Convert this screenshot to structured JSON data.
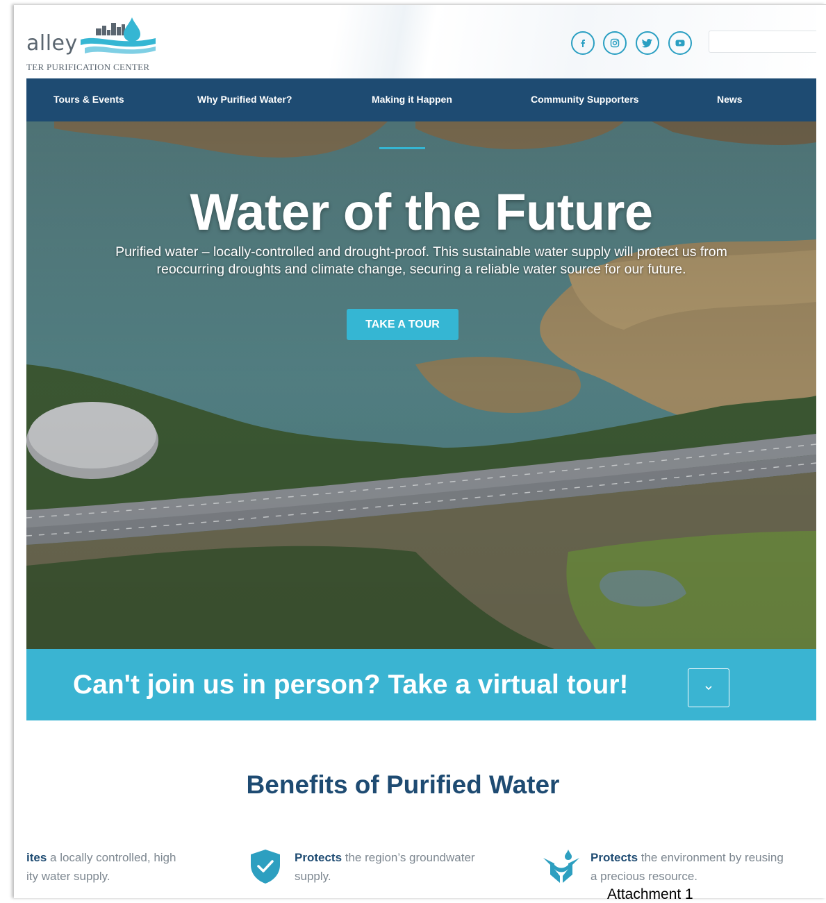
{
  "header": {
    "logo_word": "alley",
    "logo_subtitle": "TER PURIFICATION CENTER",
    "social_icons": [
      "facebook-icon",
      "instagram-icon",
      "twitter-icon",
      "youtube-icon"
    ],
    "search_placeholder": ""
  },
  "nav": {
    "items": [
      {
        "label": "Tours & Events"
      },
      {
        "label": "Why Purified Water?"
      },
      {
        "label": "Making it Happen"
      },
      {
        "label": "Community Supporters"
      },
      {
        "label": "News"
      }
    ]
  },
  "hero": {
    "title": "Water of the Future",
    "subtitle_line1": "Purified water –  locally-controlled and drought-proof. This sustainable water supply will protect us from",
    "subtitle_line2": "reoccurring droughts and climate change, securing a reliable water source for our future.",
    "cta_label": "TAKE A TOUR"
  },
  "virtual_tour": {
    "text": "Can't join us in person? Take a virtual tour!"
  },
  "benefits": {
    "title": "Benefits of Purified Water",
    "items": [
      {
        "bold": "ites",
        "line1_rest": " a locally controlled, high",
        "line2": "ity water supply."
      },
      {
        "bold": "Protects",
        "line1_rest": " the region’s groundwater",
        "line2": "supply."
      },
      {
        "bold": "Protects",
        "line1_rest": " the environment by reusing",
        "line2": "a precious resource."
      }
    ]
  },
  "caption": "Attachment 1",
  "colors": {
    "nav_bg": "#1e4b72",
    "accent": "#35b6d3",
    "heading": "#1e4b72",
    "banner": "#3ab4d2"
  }
}
